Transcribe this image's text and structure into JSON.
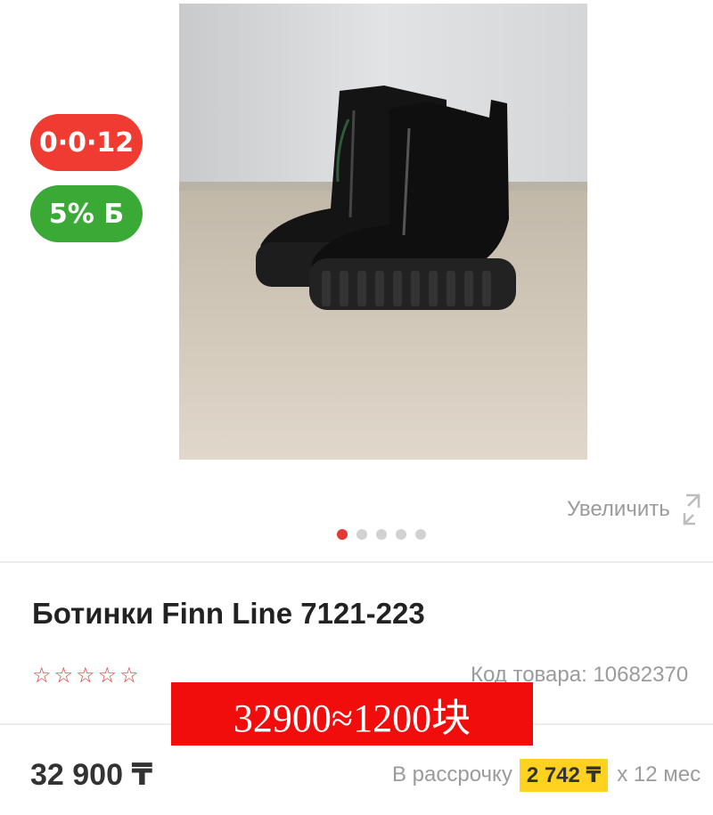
{
  "badges": {
    "installment": "0·0·12",
    "bonus": "5% Б"
  },
  "gallery": {
    "zoom_label": "Увеличить",
    "dot_count": 5,
    "active_dot": 0
  },
  "product": {
    "title": "Ботинки Finn Line 7121-223",
    "rating_stars": 0,
    "sku_text": "Код товара: 10682370",
    "price": "32 900 ₸"
  },
  "overlay": {
    "text": "32900≈1200块"
  },
  "installment": {
    "prefix": "В рассрочку",
    "monthly": "2 742 ₸",
    "suffix": "х 12 мес"
  },
  "colors": {
    "accent_red": "#e53935",
    "bonus_green": "#3aa935",
    "installment_red": "#ef3b31",
    "monthly_highlight": "#ffd21f"
  }
}
